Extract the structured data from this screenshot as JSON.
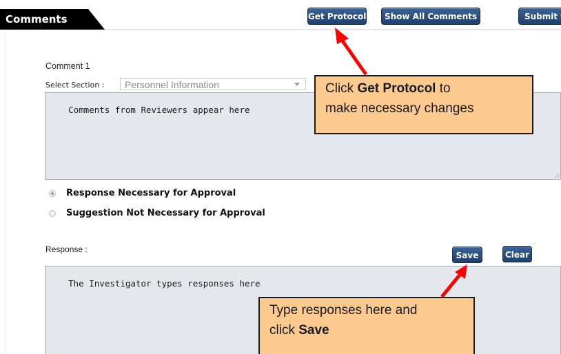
{
  "header": {
    "title": "Comments",
    "buttons": {
      "get_protocol": "Get Protocol",
      "show_all_comments": "Show All Comments",
      "submit": "Submit to"
    }
  },
  "comment": {
    "heading": "Comment 1",
    "select_section_label": "Select Section :",
    "select_section_value": "Personnel Information",
    "reviewer_text": "Comments from Reviewers appear here",
    "options": [
      {
        "label": "Response Necessary for Approval",
        "selected": true
      },
      {
        "label": "Suggestion Not Necessary for Approval",
        "selected": false
      }
    ]
  },
  "response": {
    "label": "Response :",
    "save_label": "Save",
    "clear_label": "Clear",
    "text": "The Investigator types responses here"
  },
  "callouts": {
    "top": {
      "prefix": "Click ",
      "bold": "Get Protocol",
      "suffix": " to",
      "line2": "make necessary changes"
    },
    "bottom": {
      "line1": "Type responses here and",
      "prefix": "click ",
      "bold": "Save"
    }
  },
  "colors": {
    "button": "#2b4f80",
    "callout_fill": "#fcc98e",
    "arrow": "#ff0000",
    "textarea_bg": "#e4e8ed"
  }
}
